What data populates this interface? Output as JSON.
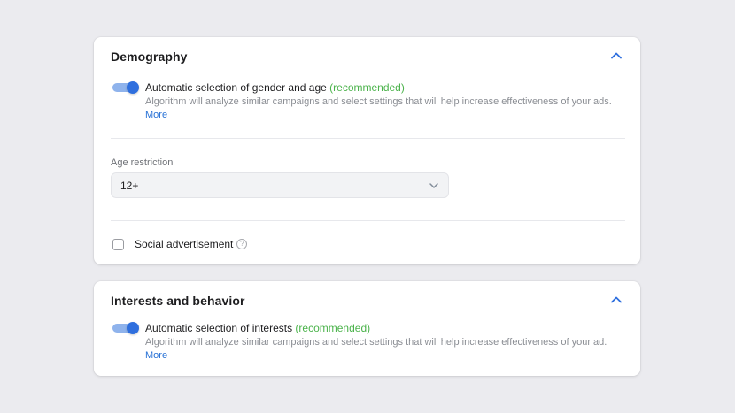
{
  "demography": {
    "title": "Demography",
    "collapse_icon": "chevron-up-icon",
    "auto_toggle": {
      "on": true,
      "label": "Automatic selection of gender and age",
      "recommended": "(recommended)",
      "description": "Algorithm will analyze similar campaigns and select settings that will help increase effectiveness of your ads.",
      "more": "More"
    },
    "age_restriction": {
      "label": "Age restriction",
      "value": "12+"
    },
    "social_ad": {
      "checked": false,
      "label": "Social advertisement",
      "help_glyph": "?"
    }
  },
  "interests": {
    "title": "Interests and behavior",
    "collapse_icon": "chevron-up-icon",
    "auto_toggle": {
      "on": true,
      "label": "Automatic selection of interests",
      "recommended": "(recommended)",
      "description": "Algorithm will analyze similar campaigns and select settings that will help increase effectiveness of your ad.",
      "more": "More"
    }
  },
  "colors": {
    "accent": "#2f6fde",
    "link": "#2a73d6",
    "recommended": "#4bb34b",
    "background": "#ebebef"
  }
}
